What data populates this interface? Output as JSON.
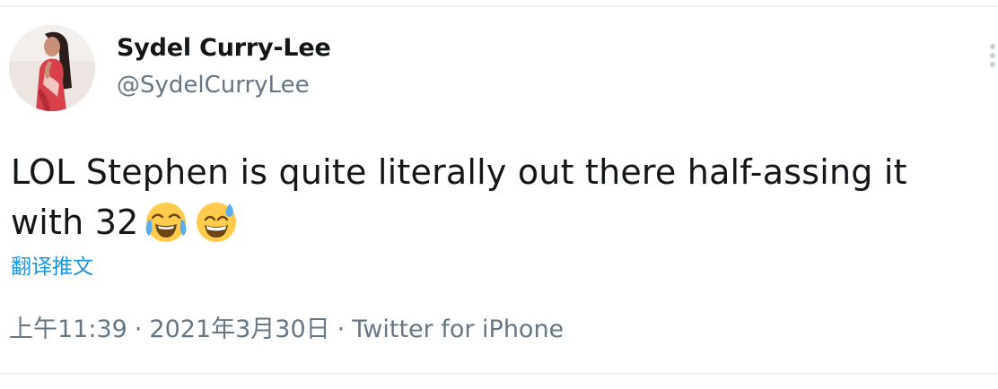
{
  "author": {
    "display_name": "Sydel Curry-Lee",
    "handle": "@SydelCurryLee"
  },
  "tweet": {
    "text_line1": "LOL Stephen is quite literally out there half-assing it",
    "text_line2": "with 32",
    "emojis": [
      "face-with-tears-of-joy-icon",
      "grinning-face-with-sweat-icon"
    ]
  },
  "translate_link": "翻译推文",
  "meta": {
    "time": "上午11:39",
    "date": "2021年3月30日",
    "source": "Twitter for iPhone",
    "separator": "·"
  },
  "colors": {
    "link": "#1b95e0",
    "secondary_text": "#657786",
    "primary_text": "#14171a"
  }
}
